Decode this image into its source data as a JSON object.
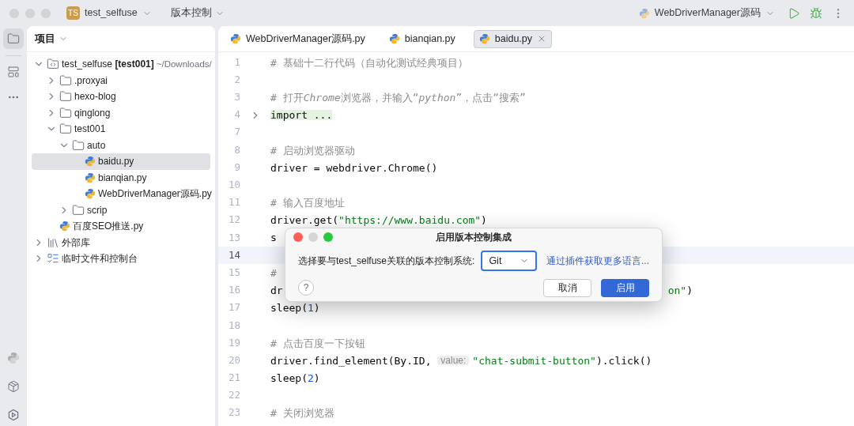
{
  "titlebar": {
    "project_badge": "TS",
    "project": "test_selfuse",
    "vcs_menu": "版本控制",
    "run_config": "WebDriverManager源码"
  },
  "project_panel": {
    "title": "项目",
    "tree": [
      {
        "kind": "module",
        "label": "test_selfuse **[test001]**",
        "path": "~/Downloads/",
        "expanded": true,
        "selected": false,
        "children": [
          {
            "kind": "folder",
            "label": ".proxyai",
            "expanded": false,
            "selected": false
          },
          {
            "kind": "folder",
            "label": "hexo-blog",
            "expanded": false,
            "selected": false
          },
          {
            "kind": "folder",
            "label": "qinglong",
            "expanded": false,
            "selected": false
          },
          {
            "kind": "folder",
            "label": "test001",
            "expanded": true,
            "selected": false,
            "children": [
              {
                "kind": "folder",
                "label": "auto",
                "expanded": true,
                "selected": false,
                "children": [
                  {
                    "kind": "python",
                    "label": "baidu.py",
                    "selected": true
                  },
                  {
                    "kind": "python",
                    "label": "bianqian.py",
                    "selected": false
                  },
                  {
                    "kind": "python",
                    "label": "WebDriverManager源码.py",
                    "selected": false
                  }
                ]
              },
              {
                "kind": "folder",
                "label": "scrip",
                "expanded": false,
                "selected": false
              }
            ]
          },
          {
            "kind": "python",
            "label": "百度SEO推送.py",
            "selected": false
          }
        ]
      },
      {
        "kind": "library",
        "label": "外部库",
        "expanded": false,
        "selected": false
      },
      {
        "kind": "scratch",
        "label": "临时文件和控制台",
        "expanded": false,
        "selected": false
      }
    ]
  },
  "tabs": [
    {
      "label": "WebDriverManager源码.py",
      "selected": false
    },
    {
      "label": "bianqian.py",
      "selected": false
    },
    {
      "label": "baidu.py",
      "selected": true
    }
  ],
  "code": [
    {
      "number": "1",
      "current": false,
      "segments": [
        {
          "kind": "comment",
          "text": "# 基础十二行代码（自动化测试经典项目）"
        }
      ]
    },
    {
      "number": "2",
      "current": false
    },
    {
      "number": "3",
      "current": false,
      "segments": [
        {
          "kind": "comment",
          "text": "# 打开"
        },
        {
          "kind": "comment_italic",
          "text": "Chrome"
        },
        {
          "kind": "comment",
          "text": "浏览器，并输入“"
        },
        {
          "kind": "comment_italic",
          "text": "python"
        },
        {
          "kind": "comment",
          "text": "”，点击“搜索”"
        }
      ]
    },
    {
      "number": "4",
      "current": false,
      "folded": true,
      "segments": [
        {
          "kind": "folded",
          "text": "import ..."
        }
      ]
    },
    {
      "number": "7",
      "current": false
    },
    {
      "number": "8",
      "current": false,
      "segments": [
        {
          "kind": "comment",
          "text": "# 启动浏览器驱动"
        }
      ]
    },
    {
      "number": "9",
      "current": false,
      "segments": [
        {
          "kind": "plain",
          "text": "driver = webdriver.Chrome()"
        }
      ]
    },
    {
      "number": "10",
      "current": false
    },
    {
      "number": "11",
      "current": false,
      "segments": [
        {
          "kind": "comment",
          "text": "# 输入百度地址"
        }
      ]
    },
    {
      "number": "12",
      "current": false,
      "segments": [
        {
          "kind": "plain",
          "text": "driver.get("
        },
        {
          "kind": "string",
          "text": "\"https://www.baidu.com\""
        },
        {
          "kind": "plain",
          "text": ")"
        }
      ]
    },
    {
      "number": "13",
      "current": false,
      "segments": [
        {
          "kind": "plain",
          "text": "s"
        }
      ]
    },
    {
      "number": "14",
      "current": true
    },
    {
      "number": "15",
      "current": false,
      "segments": [
        {
          "kind": "comment",
          "text": "#"
        }
      ]
    },
    {
      "number": "16",
      "current": false,
      "covered": true,
      "segments": [
        {
          "kind": "plain",
          "text": "dr"
        },
        {
          "kind": "string",
          "text": "on\""
        },
        {
          "kind": "plain",
          "text": ")"
        }
      ]
    },
    {
      "number": "17",
      "current": false,
      "segments": [
        {
          "kind": "plain",
          "text": "sleep("
        },
        {
          "kind": "number",
          "text": "1"
        },
        {
          "kind": "plain",
          "text": ")"
        }
      ]
    },
    {
      "number": "18",
      "current": false
    },
    {
      "number": "19",
      "current": false,
      "segments": [
        {
          "kind": "comment",
          "text": "# 点击百度一下按钮"
        }
      ]
    },
    {
      "number": "20",
      "current": false,
      "segments": [
        {
          "kind": "plain",
          "text": "driver.find_element(By.ID, "
        },
        {
          "kind": "hint",
          "text": "value:"
        },
        {
          "kind": "string",
          "text": "\"chat-submit-button\""
        },
        {
          "kind": "plain",
          "text": ").click()"
        }
      ]
    },
    {
      "number": "21",
      "current": false,
      "segments": [
        {
          "kind": "plain",
          "text": "sleep("
        },
        {
          "kind": "number",
          "text": "2"
        },
        {
          "kind": "plain",
          "text": ")"
        }
      ]
    },
    {
      "number": "22",
      "current": false
    },
    {
      "number": "23",
      "current": false,
      "segments": [
        {
          "kind": "comment",
          "text": "# 关闭浏览器"
        }
      ]
    }
  ],
  "dialog": {
    "title": "启用版本控制集成",
    "label": "选择要与test_selfuse关联的版本控制系统:",
    "value": "Git",
    "link": "通过插件获取更多语言...",
    "help": "?",
    "buttons": [
      {
        "label": "取消",
        "kind": "secondary"
      },
      {
        "label": "启用",
        "kind": "primary"
      }
    ]
  }
}
